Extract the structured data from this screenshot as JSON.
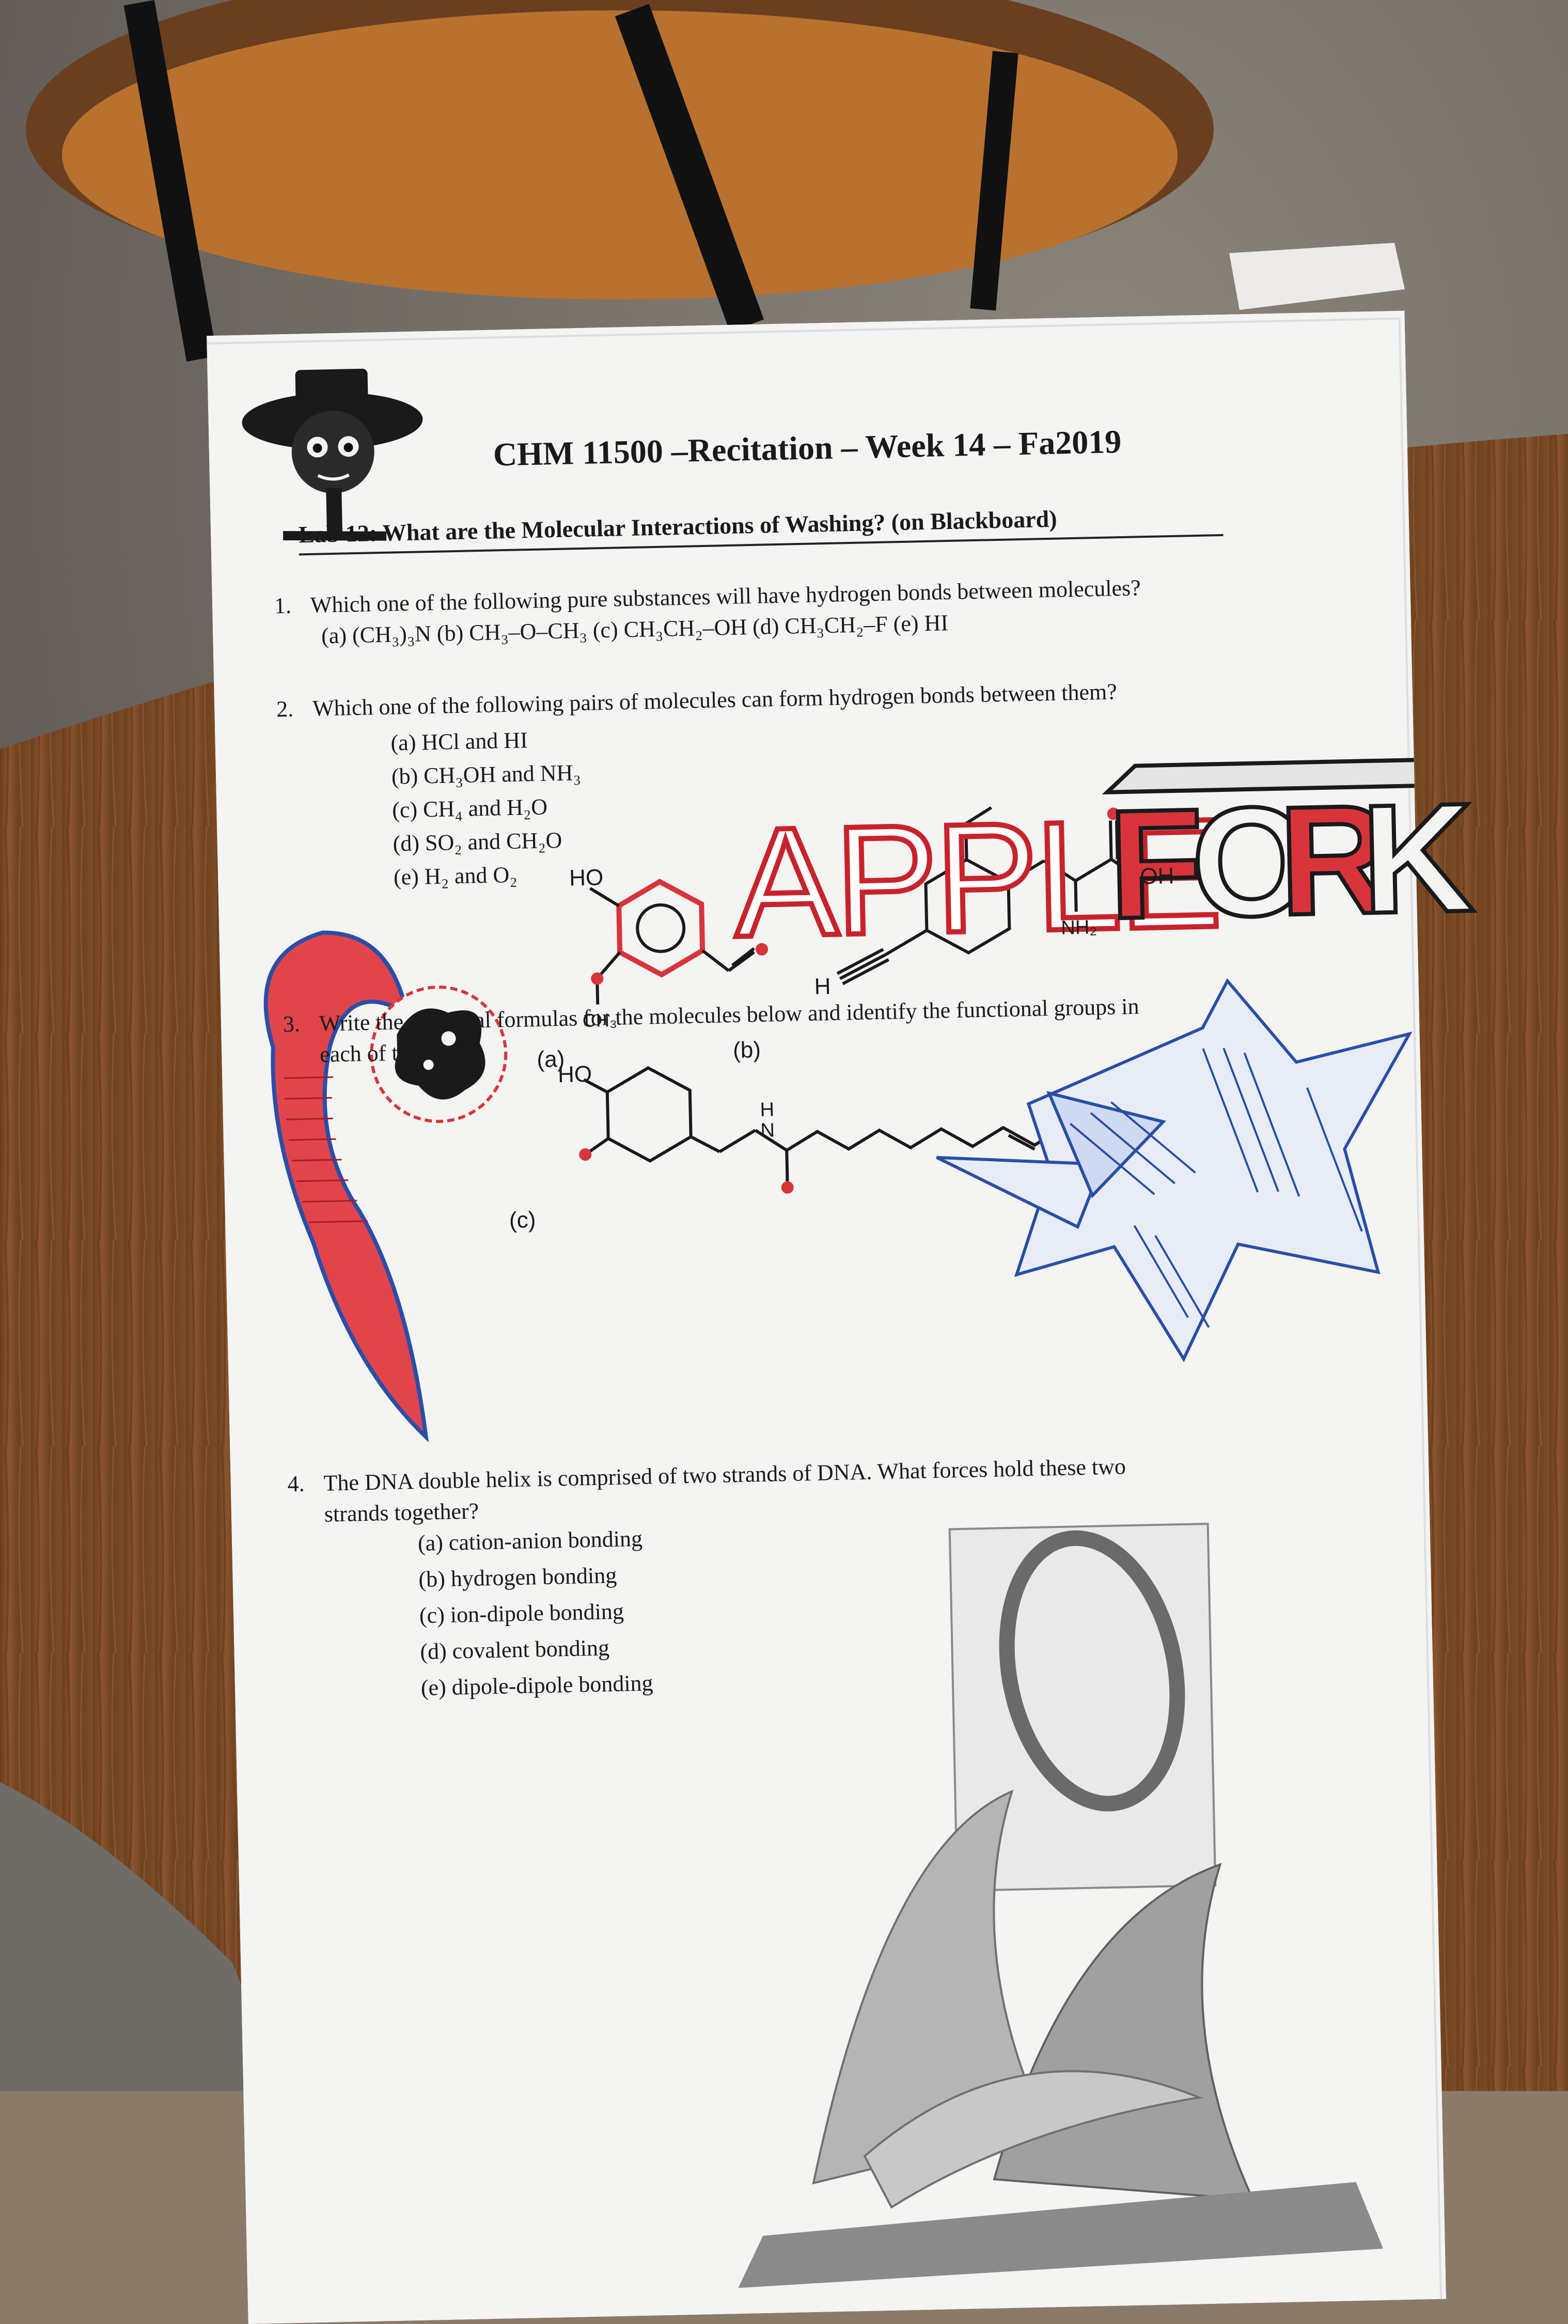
{
  "worksheet": {
    "title": "CHM 11500 –Recitation – Week 14 – Fa2019",
    "subtitle": "Lab 12:  What are the Molecular Interactions of Washing?  (on Blackboard)",
    "q1": {
      "number": "1.",
      "text": "Which one of the following pure substances will have hydrogen bonds between molecules?",
      "options": "(a)  (CH₃)₃N    (b)  CH₃–O–CH₃    (c)  CH₃CH₂–OH    (d)  CH₃CH₂–F    (e)  HI"
    },
    "q2": {
      "number": "2.",
      "text": "Which one of the following pairs of molecules can form hydrogen bonds between them?",
      "options": [
        "(a)  HCl and HI",
        "(b)  CH₃OH and NH₃",
        "(c)  CH₄ and H₂O",
        "(d)  SO₂ and CH₂O",
        "(e)  H₂ and O₂"
      ]
    },
    "q3": {
      "number": "3.",
      "text_line1": "Write the chemical formulas for the molecules below and identify the functional groups in",
      "text_line2": "each of them:",
      "molecule_labels": {
        "a": "(a)",
        "b": "(b)",
        "c": "(c)",
        "a_ho": "HO",
        "a_ch3": "CH₃",
        "b_h": "H",
        "b_nh2": "NH₂",
        "b_oh": "OH",
        "c_ho": "HO",
        "c_nh": "H",
        "c_n": "N"
      }
    },
    "q4": {
      "number": "4.",
      "text_line1": "The DNA double helix is comprised of two strands of DNA.  What forces hold these two",
      "text_line2": "strands together?",
      "options": [
        "(a)   cation-anion bonding",
        "(b)   hydrogen bonding",
        "(c)   ion-dipole bonding",
        "(d)   covalent bonding",
        "(e)   dipole-dipole bonding"
      ]
    }
  },
  "doodles": {
    "apple_text": "APPLE",
    "fork_letters": [
      "F",
      "O",
      "R",
      "K"
    ]
  },
  "colors": {
    "red_ink": "#d9343c",
    "blue_ink": "#2a4ea8",
    "table_wood": "#7a4a24",
    "paper": "#f4f4f2"
  }
}
